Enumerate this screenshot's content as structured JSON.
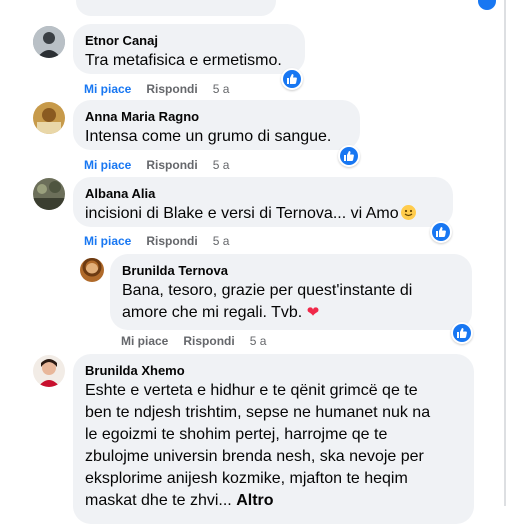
{
  "comments": [
    {
      "author": "Etnor Canaj",
      "text": "Tra metafisica e ermetismo.",
      "like_label": "Mi piace",
      "reply_label": "Rispondi",
      "time": "5 a"
    },
    {
      "author": "Anna Maria Ragno",
      "text": "Intensa come un grumo di sangue.",
      "like_label": "Mi piace",
      "reply_label": "Rispondi",
      "time": "5 a"
    },
    {
      "author": "Albana Alia",
      "text": "incisioni di Blake e versi di Ternova... vi Amo",
      "emoji": "smiling-face",
      "like_label": "Mi piace",
      "reply_label": "Rispondi",
      "time": "5 a"
    },
    {
      "author": "Brunilda Ternova",
      "text_line1": "Bana, tesoro, grazie per quest'instante di",
      "text_line2": "amore che mi regali. Tvb.",
      "emoji": "red-heart",
      "like_label": "Mi piace",
      "reply_label": "Rispondi",
      "time": "5 a"
    },
    {
      "author": "Brunilda Xhemo",
      "lines": [
        "Eshte e verteta e hidhur e te qënit grimcë qe te",
        "ben te ndjesh trishtim, sepse ne humanet nuk na",
        "le egoizmi te shohim pertej, harrojme qe te",
        "zbulojme universin brenda nesh, ska nevoje per",
        "eksplorime anijesh kozmike, mjafton te heqim",
        "maskat dhe te zhvi..."
      ],
      "more_label": "Altro"
    }
  ],
  "colors": {
    "bubble": "#f0f2f5",
    "link_blue": "#1877f2",
    "muted": "#65676b",
    "heart": "#f02849"
  }
}
